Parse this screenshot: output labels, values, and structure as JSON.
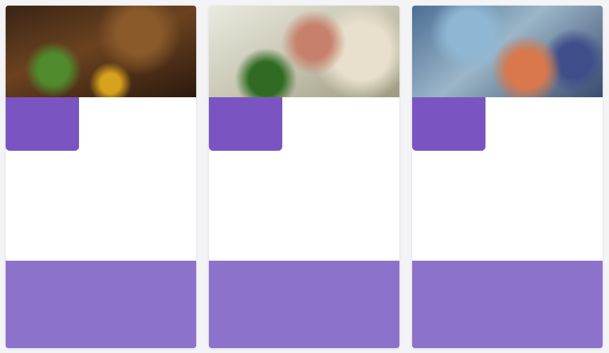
{
  "cards": [
    {
      "day": "",
      "month": "",
      "title": "",
      "section_label": "",
      "description": "",
      "footer_label": "",
      "footer_text": ""
    },
    {
      "day": "",
      "month": "",
      "title": "",
      "section_label": "",
      "description": "",
      "footer_label": "",
      "footer_text": ""
    },
    {
      "day": "",
      "month": "",
      "title": "",
      "section_label": "",
      "description": "",
      "footer_label": "",
      "footer_text": ""
    }
  ],
  "colors": {
    "badge": "#7a55c2",
    "footer": "#8d72cc",
    "card": "#ffffff"
  }
}
